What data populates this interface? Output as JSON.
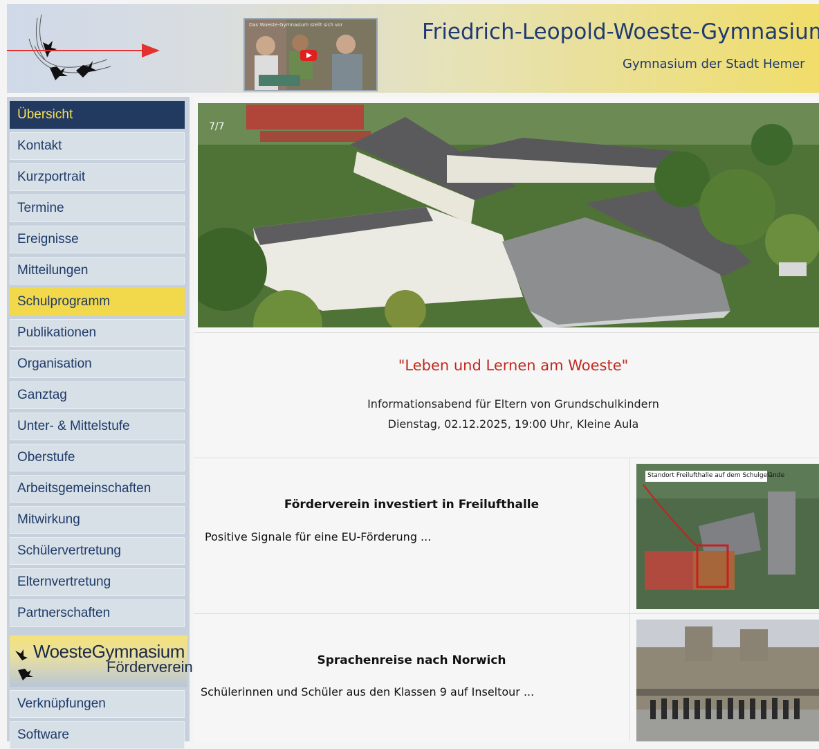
{
  "header": {
    "school_name": "Friedrich-Leopold-Woeste-Gymnasium",
    "school_subtitle": "Gymnasium der Stadt Hemer",
    "video_title": "Das Woeste-Gymnasium stellt sich vor"
  },
  "sidebar": {
    "items": [
      {
        "label": "Übersicht",
        "state": "active"
      },
      {
        "label": "Kontakt"
      },
      {
        "label": "Kurzportrait"
      },
      {
        "label": "Termine"
      },
      {
        "label": "Ereignisse"
      },
      {
        "label": "Mitteilungen"
      },
      {
        "label": "Schulprogramm",
        "state": "highlight"
      },
      {
        "label": "Publikationen"
      },
      {
        "label": "Organisation"
      },
      {
        "label": "Ganztag"
      },
      {
        "label": "Unter- & Mittelstufe"
      },
      {
        "label": "Oberstufe"
      },
      {
        "label": "Arbeitsgemeinschaften"
      },
      {
        "label": "Mitwirkung"
      },
      {
        "label": "Schülervertretung"
      },
      {
        "label": "Elternvertretung"
      },
      {
        "label": "Partnerschaften"
      }
    ],
    "foerder_logo": {
      "line1": "WoesteGymnasium",
      "line2": "Förderverein"
    },
    "bottom_items": [
      {
        "label": "Verknüpfungen"
      },
      {
        "label": "Software"
      }
    ]
  },
  "hero": {
    "counter": "7/7"
  },
  "main": {
    "motto": "\"Leben und Lernen am Woeste\"",
    "info_line1": "Informationsabend für Eltern von Grundschulkindern",
    "info_line2": "Dienstag, 02.12.2025, 19:00 Uhr, Kleine Aula"
  },
  "news": [
    {
      "title": "Förderverein investiert in Freilufthalle",
      "teaser": "Positive Signale für eine EU-Förderung ...",
      "image_caption": "Standort Freilufthalle auf dem Schulgelände"
    },
    {
      "title": "Sprachenreise nach Norwich",
      "teaser": "Schülerinnen und Schüler aus den Klassen 9 auf Inseltour ..."
    }
  ],
  "colors": {
    "nav_active_bg": "#223a60",
    "nav_active_text": "#f4e05a",
    "nav_highlight_bg": "#f2d84b",
    "brand_blue": "#1f3a70",
    "motto_red": "#c0281c"
  }
}
